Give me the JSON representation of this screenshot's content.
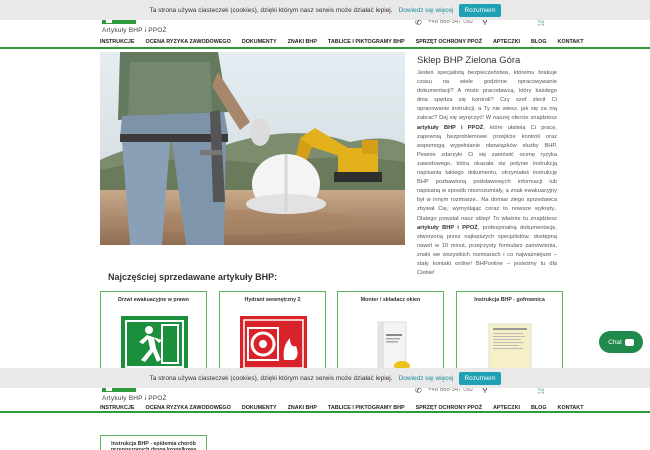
{
  "cookie": {
    "text": "Ta strona używa ciasteczek (cookies), dzięki którym nasz serwis może działać lepiej.",
    "link": "Dowiedz się więcej",
    "button": "Rozumiem"
  },
  "header": {
    "logo_text": "Artykuły BHP i PPOŻ",
    "phone": "+48 668 347 092"
  },
  "nav": {
    "items": [
      "INSTRUKCJE",
      "OCENA RYZYKA ZAWODOWEGO",
      "DOKUMENTY",
      "ZNAKI BHP",
      "TABLICE I PIKTOGRAMY BHP",
      "SPRZĘT OCHRONY PPOŻ",
      "APTECZKI",
      "BLOG",
      "KONTAKT"
    ]
  },
  "shop": {
    "title": "Sklep BHP Zielona Góra",
    "p1": "Jesteś specjalistą bezpieczeństwa, któremu brakuje czasu na wiele godzinne opracowywanie dokumentacji? A może pracodawcą, który każdego dnia spędza się kontroli? Czy szef zlecił Ci opracowanie instrukcji, a Ty nie wiesz, jak się za nią zabrać? Daj się wyręczyć! W naszej ofercie znajdziesz",
    "b1": "artykuły BHP i PPOŻ",
    "p2": ", które ułatwią Ci pracę, zapewnią bezproblemowe przejście kontroli oraz wspomogą wypełnianie obowiązków służby BHP. Pewnie zdarzyło Ci się zamówić ocenę ryzyka zawodowego, która okazała się jedynie instrukcją napisania takiego dokumentu, otrzymałeś instrukcję BHP pozbawioną podstawowych informacji lub napisaną w sposób niezrozumiały, a znak ewakuacyjny był w innym rozmiarze.. Na domiar złego sprzedawca zbywał Cię, wymyślając coraz to nowsze wykręty.. Dlatego powstał nasz sklep! To właśnie tu znajdziesz",
    "b2": "artykuły BHP i PPOŻ",
    "p3": ", profesjonalną dokumentację, stworzoną przez najlepszych specjalistów, dostępną nawet w 10 minut, przejrzysty formularz zamówienia, znaki we wszystkich rozmiarach i co najważniejsze – stały kontakt online! BHPonline – jesteśmy tu dla Ciebie!"
  },
  "products": {
    "heading": "Najczęściej sprzedawane artykuły BHP:",
    "items": [
      {
        "name": "Drzwi ewakuacyjne w prawo"
      },
      {
        "name": "Hydrant wewnętrzny 2"
      },
      {
        "name": "Monter / składacz okien"
      },
      {
        "name": "Instrukcja BHP - gofrownica"
      }
    ],
    "next": "Instrukcja BHP - epidemia chorób przenoszonych drogą kropelkową"
  },
  "chat": {
    "label": "Chat"
  },
  "colors": {
    "accent": "#2e9b3a",
    "cookie_button": "#1fa0b3",
    "chat": "#1f8a4c"
  }
}
